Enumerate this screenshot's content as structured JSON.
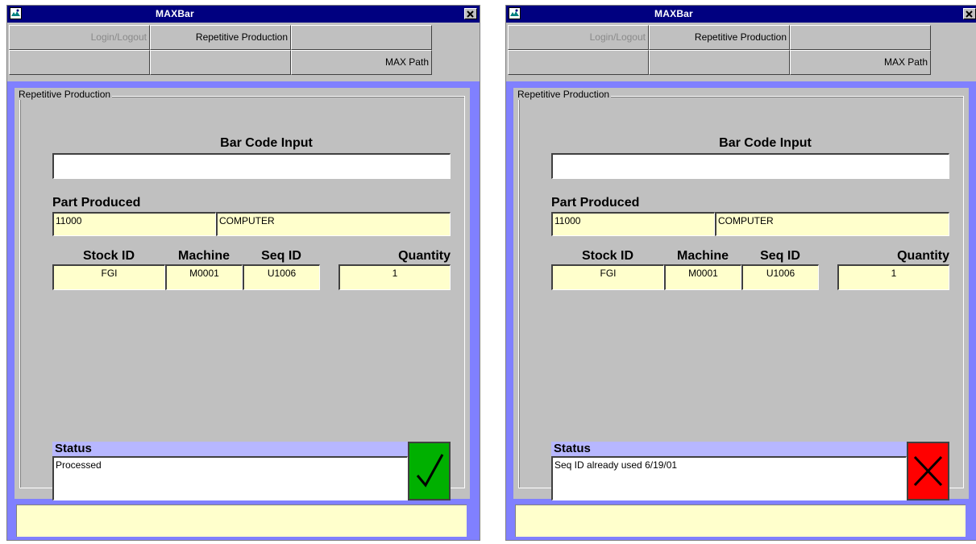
{
  "windows": [
    {
      "title": "MAXBar",
      "toolbar": {
        "login_label": "Login/Logout",
        "repetitive_label": "Repetitive Production",
        "blank1": "",
        "blank2": "",
        "blank3": "",
        "maxpath_label": "MAX Path"
      },
      "group_title": "Repetitive Production",
      "barcode_label": "Bar Code Input",
      "barcode_value": "",
      "part_label": "Part Produced",
      "part_number": "11000",
      "part_desc": "COMPUTER",
      "stock_label": "Stock ID",
      "stock_value": "FGI",
      "machine_label": "Machine",
      "machine_value": "M0001",
      "seq_label": "Seq ID",
      "seq_value": "U1006",
      "quantity_label": "Quantity",
      "quantity_value": "1",
      "status_label": "Status",
      "status_message": "Processed",
      "indicator": {
        "icon": "check-icon",
        "color": "#00b000"
      }
    },
    {
      "title": "MAXBar",
      "toolbar": {
        "login_label": "Login/Logout",
        "repetitive_label": "Repetitive Production",
        "blank1": "",
        "blank2": "",
        "blank3": "",
        "maxpath_label": "MAX Path"
      },
      "group_title": "Repetitive Production",
      "barcode_label": "Bar Code Input",
      "barcode_value": "",
      "part_label": "Part Produced",
      "part_number": "11000",
      "part_desc": "COMPUTER",
      "stock_label": "Stock ID",
      "stock_value": "FGI",
      "machine_label": "Machine",
      "machine_value": "M0001",
      "seq_label": "Seq ID",
      "seq_value": "U1006",
      "quantity_label": "Quantity",
      "quantity_value": "1",
      "status_label": "Status",
      "status_message": "Seq ID already used 6/19/01",
      "indicator": {
        "icon": "x-icon",
        "color": "#ff0000"
      }
    }
  ]
}
